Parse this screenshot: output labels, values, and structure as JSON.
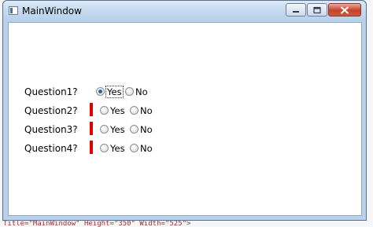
{
  "window": {
    "title": "MainWindow"
  },
  "questions": [
    {
      "label": "Question1?",
      "required": false,
      "yes": "Yes",
      "no": "No",
      "selected": "yes"
    },
    {
      "label": "Question2?",
      "required": true,
      "yes": "Yes",
      "no": "No",
      "selected": null
    },
    {
      "label": "Question3?",
      "required": true,
      "yes": "Yes",
      "no": "No",
      "selected": null
    },
    {
      "label": "Question4?",
      "required": true,
      "yes": "Yes",
      "no": "No",
      "selected": null
    }
  ],
  "background_code": "Title=\"MainWindow\" Height=\"350\" Width=\"525\">",
  "colors": {
    "required_marker": "#e00000",
    "client_bg": "#ffffff",
    "title_bar": "#c6dbf1"
  }
}
